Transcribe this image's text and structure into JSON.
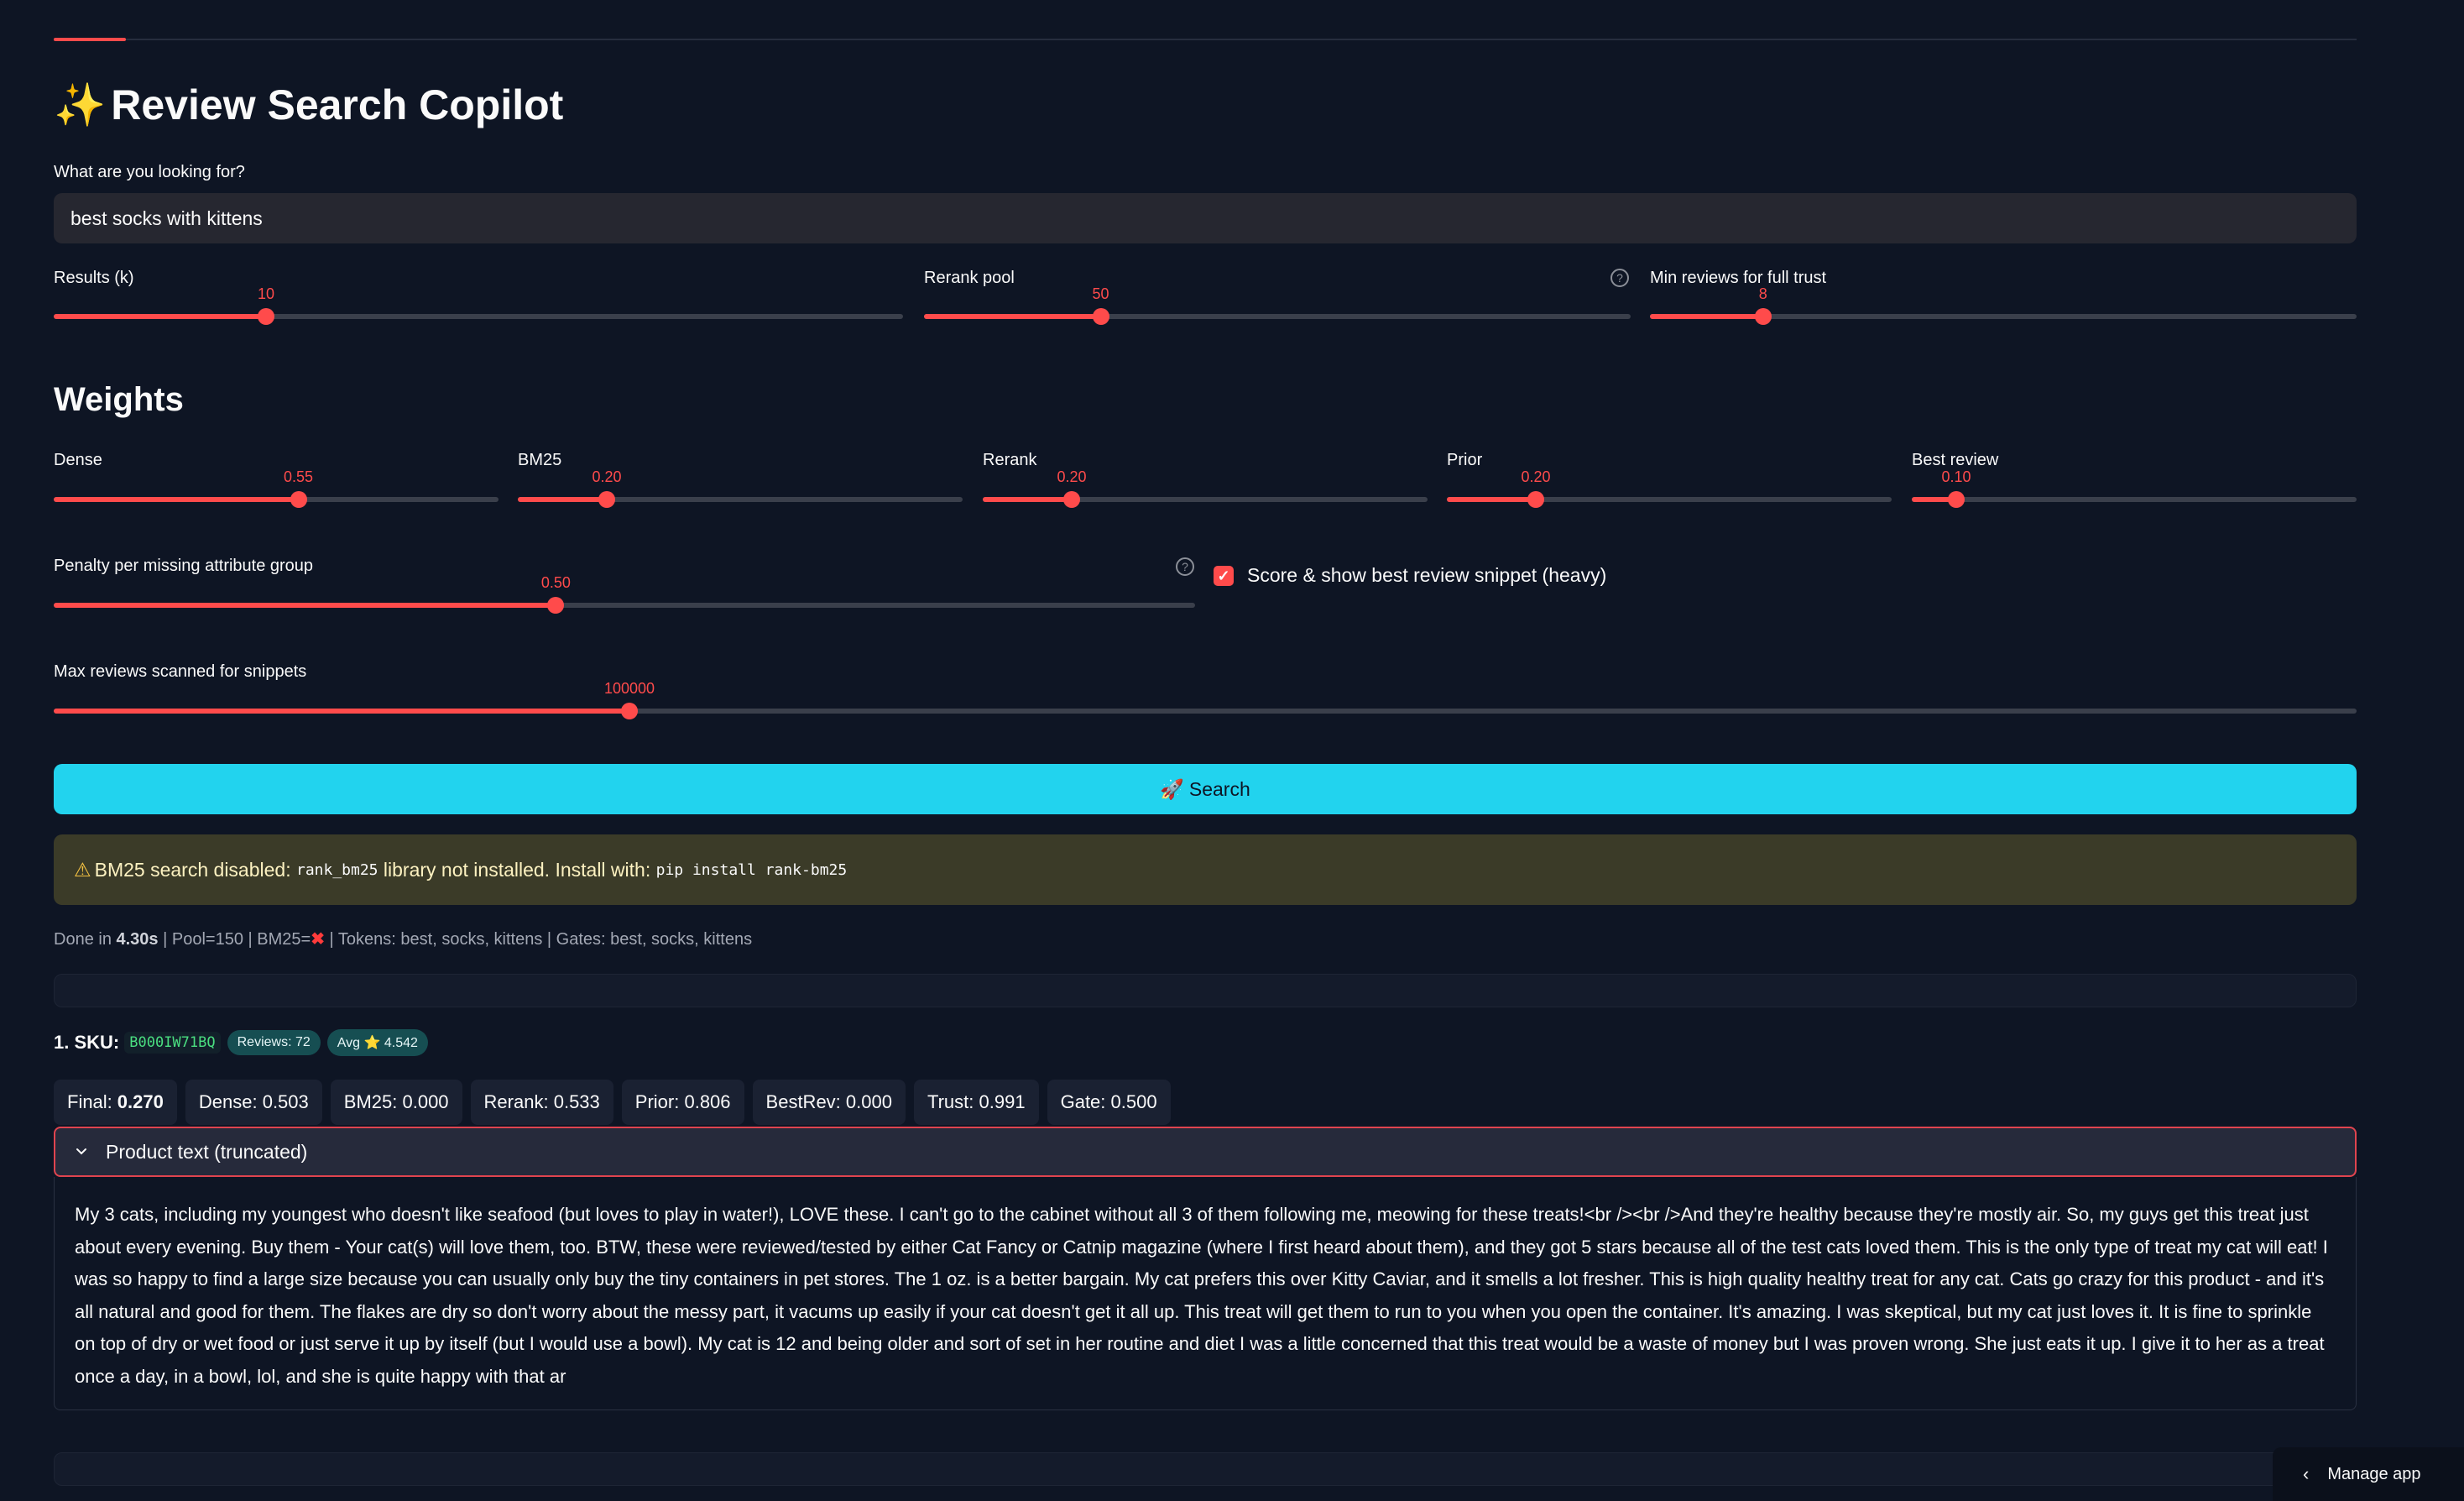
{
  "app": {
    "title": "Review Search Copilot",
    "title_icon": "✨"
  },
  "query": {
    "label": "What are you looking for?",
    "value": "best socks with kittens"
  },
  "controls": {
    "results_k": {
      "label": "Results (k)",
      "value": "10",
      "fraction": 0.25
    },
    "rerank_pool": {
      "label": "Rerank pool",
      "value": "50",
      "fraction": 0.25
    },
    "min_reviews": {
      "label": "Min reviews for full trust",
      "value": "8",
      "fraction": 0.16
    }
  },
  "weights": {
    "heading": "Weights",
    "dense": {
      "label": "Dense",
      "value": "0.55",
      "fraction": 0.55
    },
    "bm25": {
      "label": "BM25",
      "value": "0.20",
      "fraction": 0.2
    },
    "rerank": {
      "label": "Rerank",
      "value": "0.20",
      "fraction": 0.2
    },
    "prior": {
      "label": "Prior",
      "value": "0.20",
      "fraction": 0.2
    },
    "best_review": {
      "label": "Best review",
      "value": "0.10",
      "fraction": 0.1
    }
  },
  "penalty": {
    "label": "Penalty per missing attribute group",
    "value": "0.50",
    "fraction": 0.44
  },
  "snippet_toggle": {
    "label": "Score & show best review snippet (heavy)",
    "checked": true
  },
  "max_reviews": {
    "label": "Max reviews scanned for snippets",
    "value": "100000",
    "fraction": 0.25
  },
  "search_button": {
    "icon": "🚀",
    "label": "Search"
  },
  "warning": {
    "icon": "⚠",
    "text_before": "BM25 search disabled:",
    "code_lib": "rank_bm25",
    "text_middle": "library not installed. Install with:",
    "code_install": "pip install rank-bm25"
  },
  "status": {
    "prefix": "Done in",
    "time": "4.30s",
    "pool": "| Pool=150 | BM25=",
    "bm25_mark": "✖",
    "rest": "| Tokens: best, socks, kittens | Gates: best, socks, kittens"
  },
  "result": {
    "label": "1. SKU:",
    "sku": "B000IW71BQ",
    "reviews_badge": "Reviews: 72",
    "avg_badge": "Avg ⭐ 4.542",
    "scores": [
      {
        "label": "Final:",
        "value": "0.270",
        "bold": true
      },
      {
        "label": "Dense:",
        "value": "0.503"
      },
      {
        "label": "BM25:",
        "value": "0.000"
      },
      {
        "label": "Rerank:",
        "value": "0.533"
      },
      {
        "label": "Prior:",
        "value": "0.806"
      },
      {
        "label": "BestRev:",
        "value": "0.000"
      },
      {
        "label": "Trust:",
        "value": "0.991"
      },
      {
        "label": "Gate:",
        "value": "0.500"
      }
    ],
    "expander_title": "Product text (truncated)",
    "product_text": "My 3 cats, including my youngest who doesn't like seafood (but loves to play in water!), LOVE these. I can't go to the cabinet without all 3 of them following me, meowing for these treats!<br /><br />And they're healthy because they're mostly air. So, my guys get this treat just about every evening. Buy them - Your cat(s) will love them, too. BTW, these were reviewed/tested by either Cat Fancy or Catnip magazine (where I first heard about them), and they got 5 stars because all of the test cats loved them. This is the only type of treat my cat will eat! I was so happy to find a large size because you can usually only buy the tiny containers in pet stores. The 1 oz. is a better bargain. My cat prefers this over Kitty Caviar, and it smells a lot fresher. This is high quality healthy treat for any cat. Cats go crazy for this product - and it's all natural and good for them. The flakes are dry so don't worry about the messy part, it vacums up easily if your cat doesn't get it all up. This treat will get them to run to you when you open the container. It's amazing. I was skeptical, but my cat just loves it. It is fine to sprinkle on top of dry or wet food or just serve it up by itself (but I would use a bowl). My cat is 12 and being older and sort of set in her routine and diet I was a little concerned that this treat would be a waste of money but I was proven wrong. She just eats it up. I give it to her as a treat once a day, in a bowl, lol, and she is quite happy with that ar"
  },
  "manage_app": {
    "label": "Manage app"
  },
  "colors": {
    "accent": "#ff4b4b",
    "search_button": "#22d3ee",
    "sku_green": "#4ade80",
    "background": "#0e1524"
  }
}
